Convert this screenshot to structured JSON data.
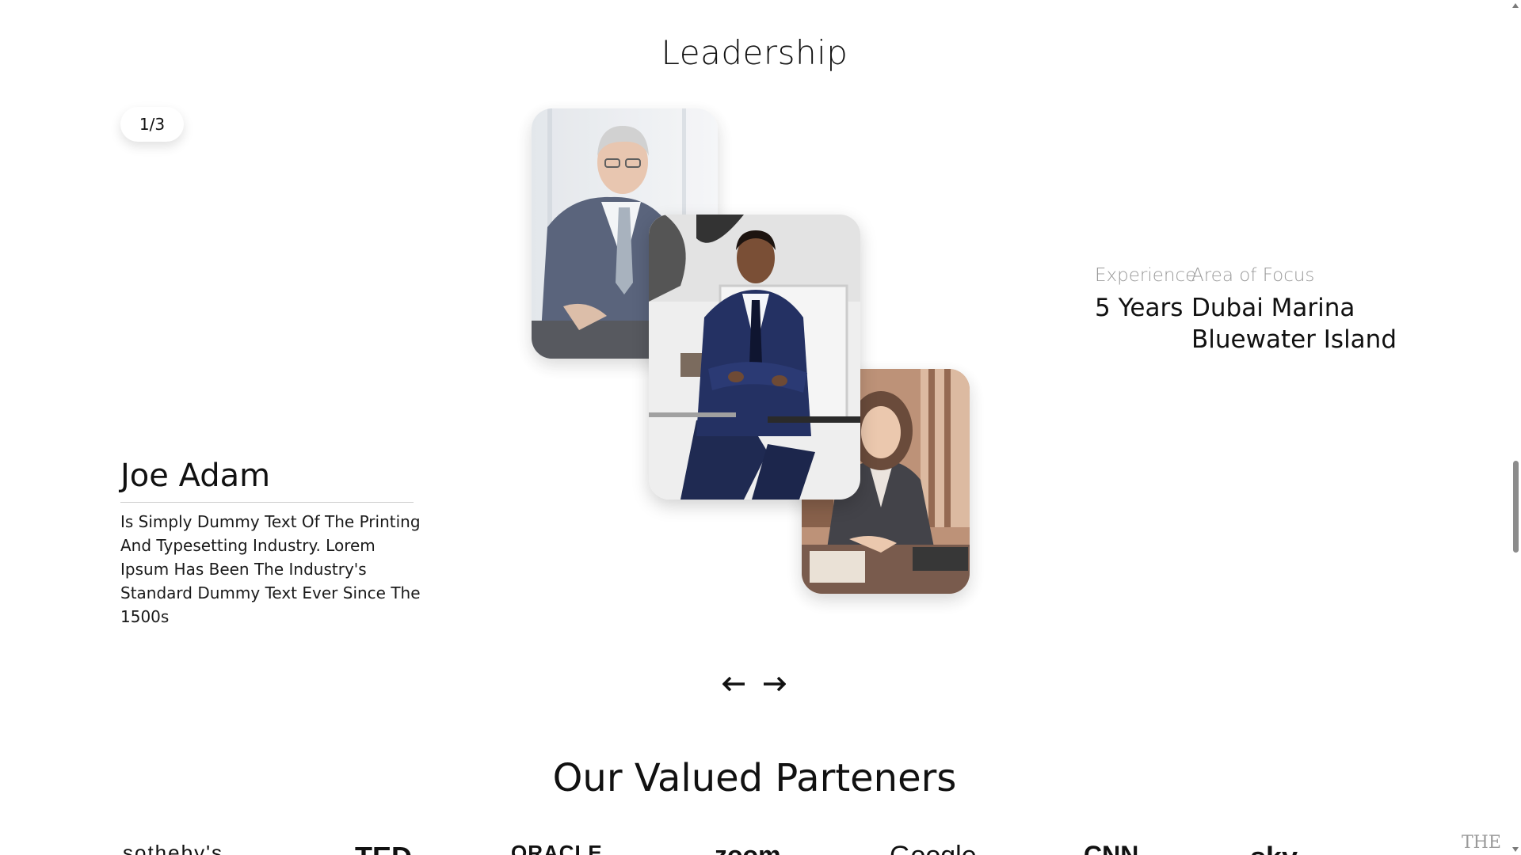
{
  "leadership": {
    "title": "Leadership",
    "counter": "1/3",
    "person": {
      "name": "Joe Adam",
      "bio": "Is Simply Dummy Text Of The Printing And Typesetting Industry. Lorem Ipsum Has Been The Industry's Standard Dummy Text Ever Since The 1500s"
    },
    "stats": {
      "experience_label": "Experience",
      "experience_value": "5 Years",
      "focus_label": "Area of Focus",
      "focus_value_line1": "Dubai Marina",
      "focus_value_line2": "Bluewater Island"
    },
    "nav": {
      "prev_icon": "arrow-left-icon",
      "next_icon": "arrow-right-icon"
    }
  },
  "partners": {
    "title": "Our Valued Parteners",
    "logos": [
      "sotheby's",
      "TED",
      "ORACLE",
      "zoom",
      "Google",
      "CNN",
      "sky",
      "THE"
    ]
  },
  "colors": {
    "text": "#111111",
    "muted": "#9a9a9a",
    "background": "#ffffff"
  }
}
